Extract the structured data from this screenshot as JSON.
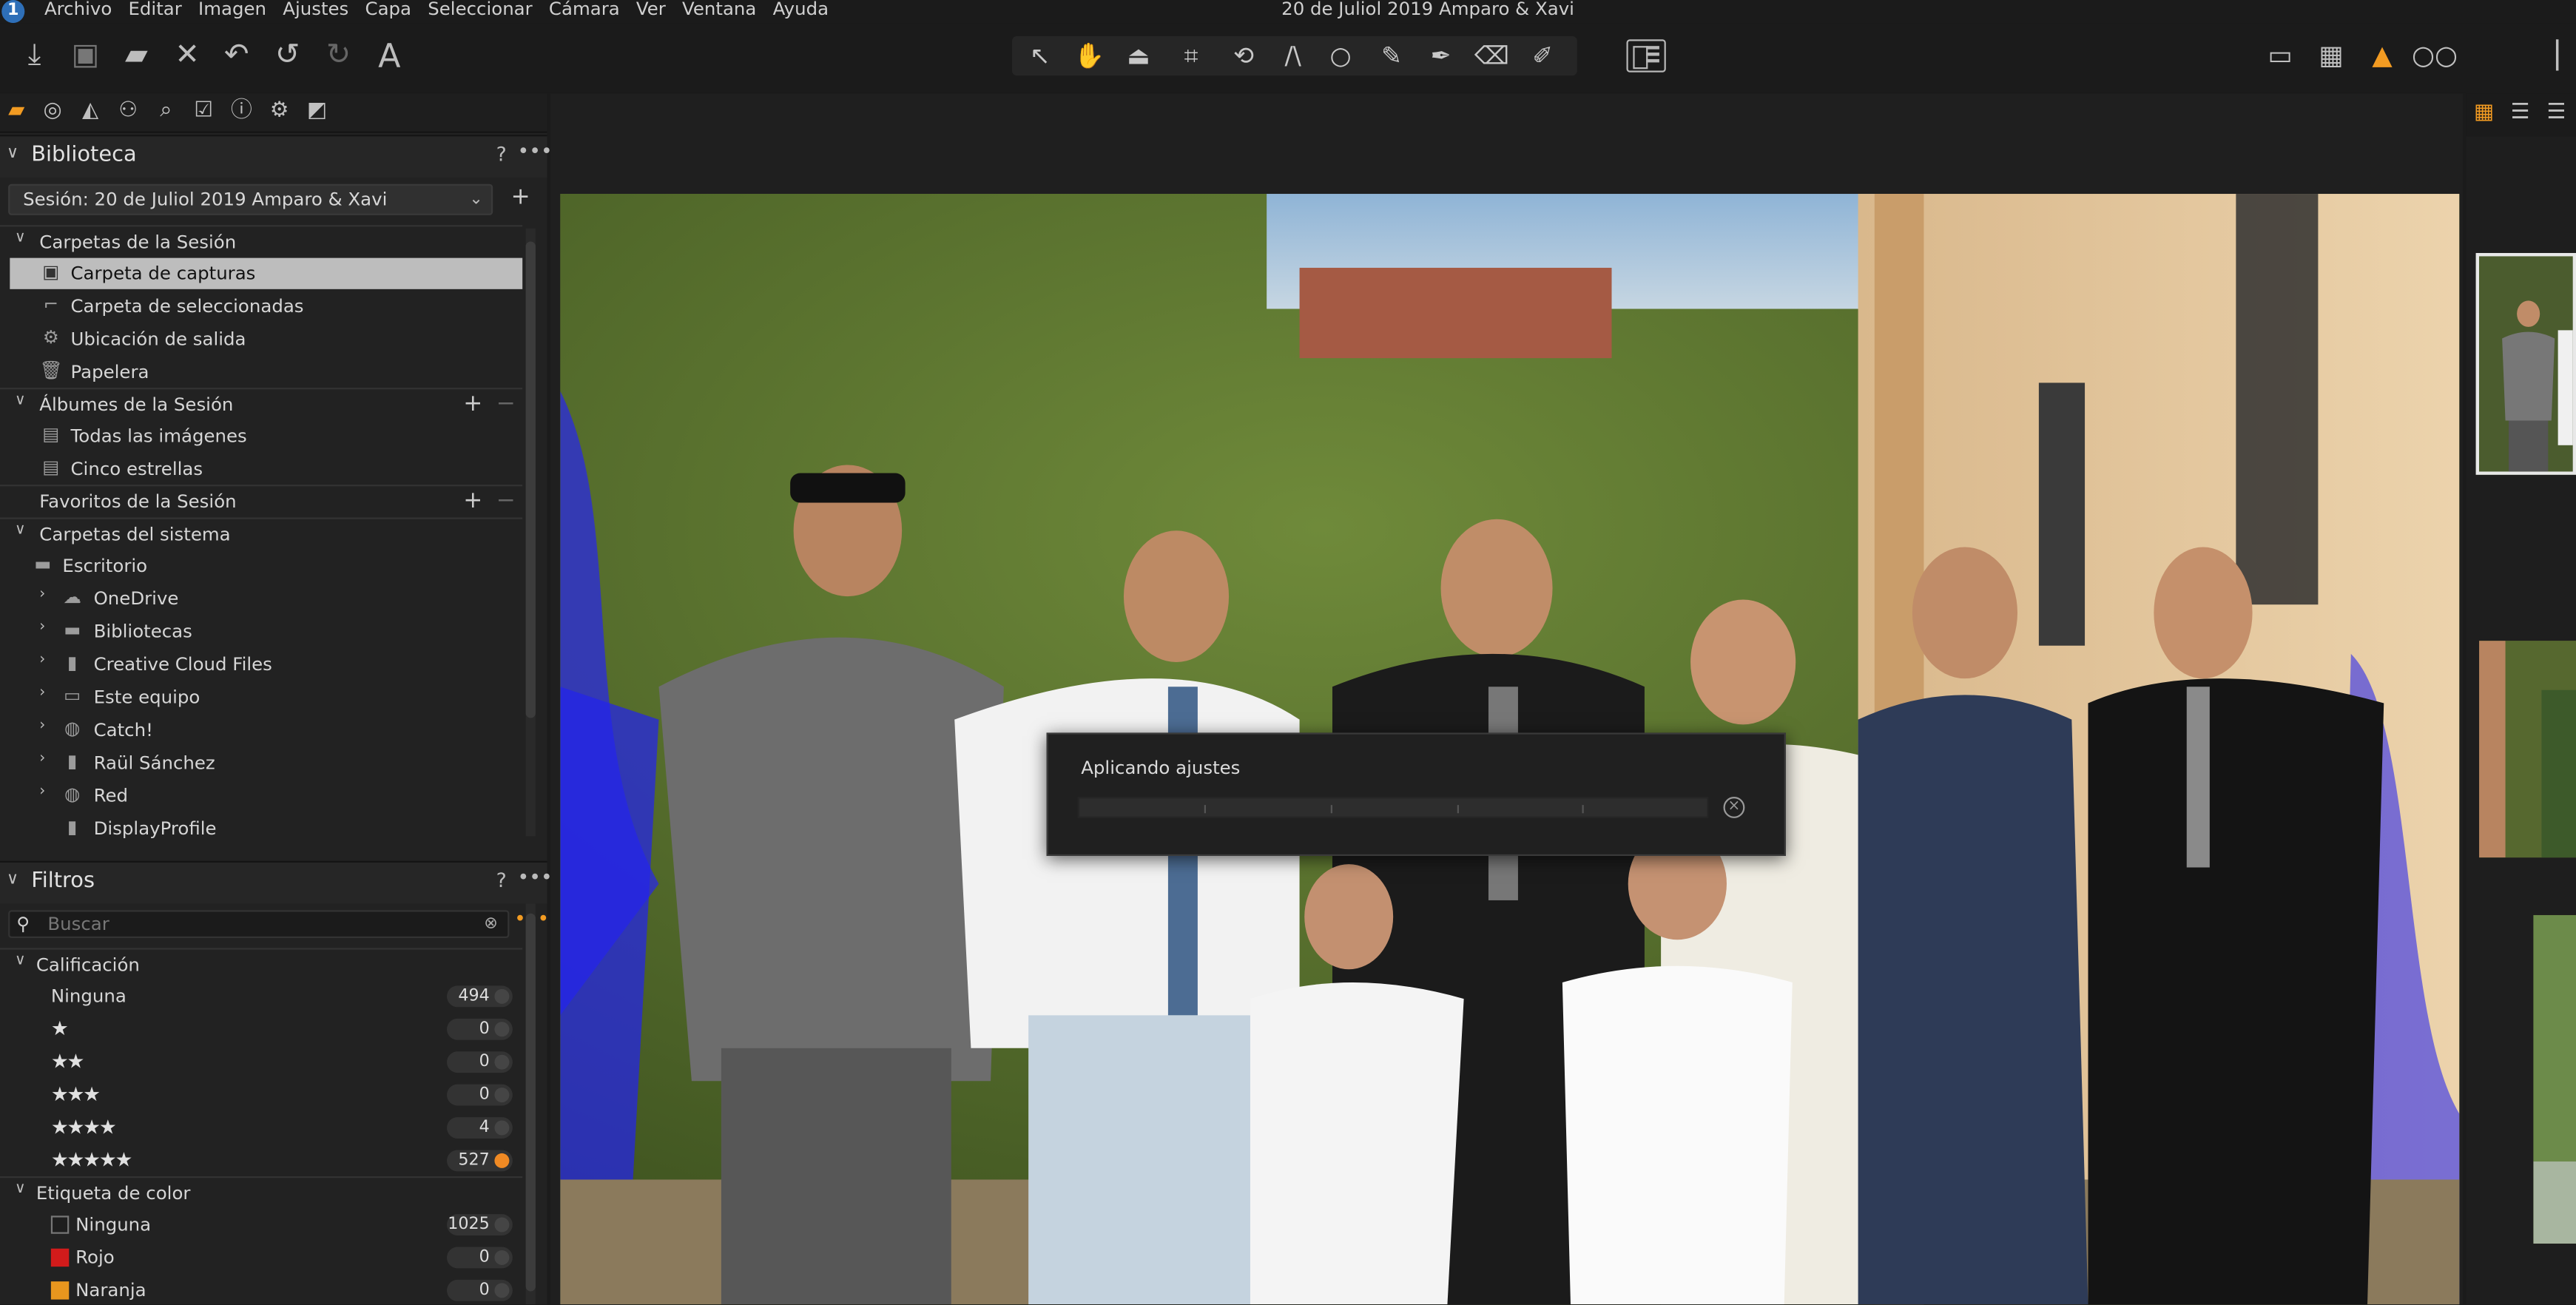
{
  "menubar": {
    "logo": "1",
    "items": [
      "Archivo",
      "Editar",
      "Imagen",
      "Ajustes",
      "Capa",
      "Seleccionar",
      "Cámara",
      "Ver",
      "Ventana",
      "Ayuda"
    ],
    "window_title": "20 de Juliol 2019 Amparo & Xavi"
  },
  "library": {
    "title": "Biblioteca",
    "help": "?",
    "more": "•••",
    "session_select": "Sesión: 20 de Juliol 2019 Amparo & Xavi",
    "session_folders_title": "Carpetas de la Sesión",
    "session_folders": [
      "Carpeta de capturas",
      "Carpeta de seleccionadas",
      "Ubicación de salida",
      "Papelera"
    ],
    "albums_title": "Álbumes de la Sesión",
    "albums": [
      "Todas las imágenes",
      "Cinco estrellas"
    ],
    "favorites_title": "Favoritos de la Sesión",
    "system_title": "Carpetas del sistema",
    "desktop": "Escritorio",
    "system_folders": [
      "OneDrive",
      "Bibliotecas",
      "Creative Cloud Files",
      "Este equipo",
      "Catch!",
      "Raül Sánchez",
      "Red",
      "DisplayProfile"
    ]
  },
  "filters": {
    "title": "Filtros",
    "help": "?",
    "more": "•••",
    "search_placeholder": "Buscar",
    "rating_title": "Calificación",
    "rating_rows": [
      {
        "label": "Ninguna",
        "count": "494"
      },
      {
        "stars": "★",
        "count": "0"
      },
      {
        "stars": "★★",
        "count": "0"
      },
      {
        "stars": "★★★",
        "count": "0"
      },
      {
        "stars": "★★★★",
        "count": "4"
      },
      {
        "stars": "★★★★★",
        "count": "527"
      }
    ],
    "color_title": "Etiqueta de color",
    "color_rows": [
      {
        "label": "Ninguna",
        "count": "1025",
        "color": "#1e1e1e"
      },
      {
        "label": "Rojo",
        "count": "0",
        "color": "#d21b1b"
      },
      {
        "label": "Naranja",
        "count": "0",
        "color": "#e8961e"
      }
    ]
  },
  "dialog": {
    "title": "Aplicando ajustes",
    "progress": 0
  },
  "colors": {
    "accent": "#f29b22",
    "clipping_overlay": "#1a1aff"
  }
}
